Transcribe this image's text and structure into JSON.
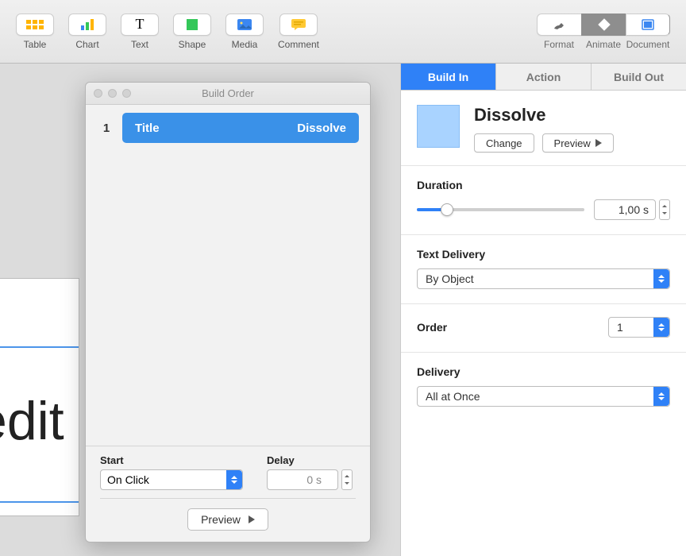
{
  "toolbar": {
    "left": [
      {
        "id": "table",
        "label": "Table"
      },
      {
        "id": "chart",
        "label": "Chart"
      },
      {
        "id": "text",
        "label": "Text"
      },
      {
        "id": "shape",
        "label": "Shape"
      },
      {
        "id": "media",
        "label": "Media"
      },
      {
        "id": "comment",
        "label": "Comment"
      }
    ],
    "right": [
      {
        "id": "format",
        "label": "Format"
      },
      {
        "id": "animate",
        "label": "Animate",
        "active": true
      },
      {
        "id": "document",
        "label": "Document"
      }
    ]
  },
  "canvas": {
    "visible_text": "edit"
  },
  "build_order": {
    "title": "Build Order",
    "items": [
      {
        "index": "1",
        "name": "Title",
        "effect": "Dissolve"
      }
    ],
    "start_label": "Start",
    "start_value": "On Click",
    "delay_label": "Delay",
    "delay_value": "0 s",
    "preview_label": "Preview"
  },
  "inspector": {
    "tabs": [
      {
        "id": "build_in",
        "label": "Build In",
        "active": true
      },
      {
        "id": "action",
        "label": "Action"
      },
      {
        "id": "build_out",
        "label": "Build Out"
      }
    ],
    "effect_name": "Dissolve",
    "change_label": "Change",
    "preview_label": "Preview",
    "duration_label": "Duration",
    "duration_value": "1,00 s",
    "text_delivery_label": "Text Delivery",
    "text_delivery_value": "By Object",
    "order_label": "Order",
    "order_value": "1",
    "delivery_label": "Delivery",
    "delivery_value": "All at Once"
  }
}
